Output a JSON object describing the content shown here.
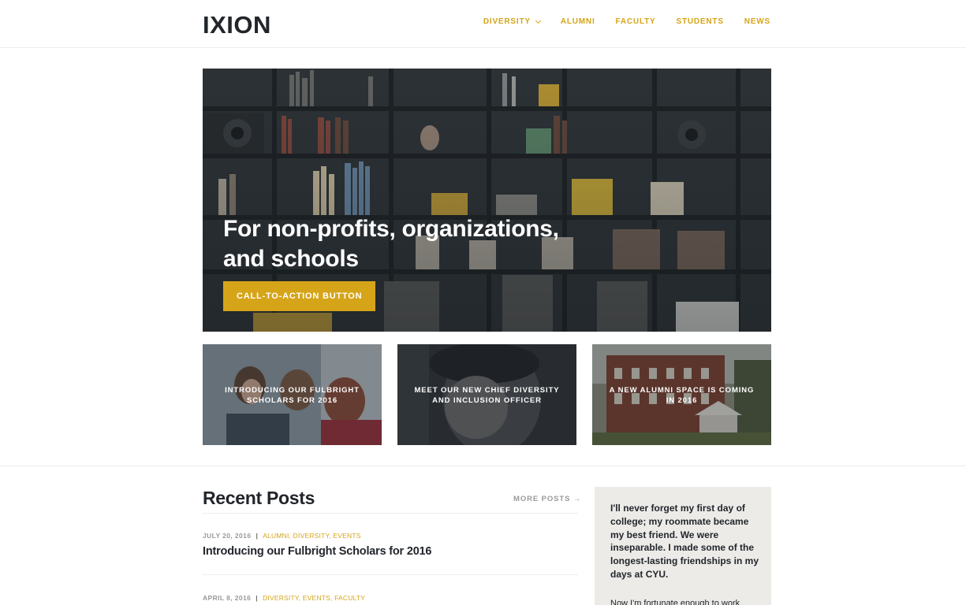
{
  "site": {
    "logo": "IXION"
  },
  "nav": {
    "items": [
      {
        "label": "DIVERSITY",
        "has_dropdown": true
      },
      {
        "label": "ALUMNI"
      },
      {
        "label": "FACULTY"
      },
      {
        "label": "STUDENTS"
      },
      {
        "label": "NEWS"
      }
    ]
  },
  "hero": {
    "title": "For non-profits, organizations, and schools",
    "cta_label": "CALL-TO-ACTION BUTTON"
  },
  "cards": [
    {
      "title": "INTRODUCING OUR FULBRIGHT SCHOLARS FOR 2016"
    },
    {
      "title": "MEET OUR NEW CHIEF DIVERSITY AND INCLUSION OFFICER"
    },
    {
      "title": "A NEW ALUMNI SPACE IS COMING IN 2016"
    }
  ],
  "recent": {
    "heading": "Recent Posts",
    "more_label": "MORE POSTS →",
    "posts": [
      {
        "date": "JULY 20, 2016",
        "categories": "ALUMNI, DIVERSITY, EVENTS",
        "title": "Introducing our Fulbright Scholars for 2016"
      },
      {
        "date": "APRIL 8, 2016",
        "categories": "DIVERSITY, EVENTS, FACULTY",
        "title": ""
      }
    ]
  },
  "testimonial": {
    "quote": "I'll never forget my first day of college; my roommate became my best friend. We were inseparable. I made some of the longest-lasting friendships in my days at CYU.",
    "continuation": "Now I'm fortunate enough to work"
  },
  "colors": {
    "accent": "#d6a419",
    "text": "#22262b",
    "muted": "#9a9a9a",
    "testimonial_bg": "#edebe8"
  }
}
